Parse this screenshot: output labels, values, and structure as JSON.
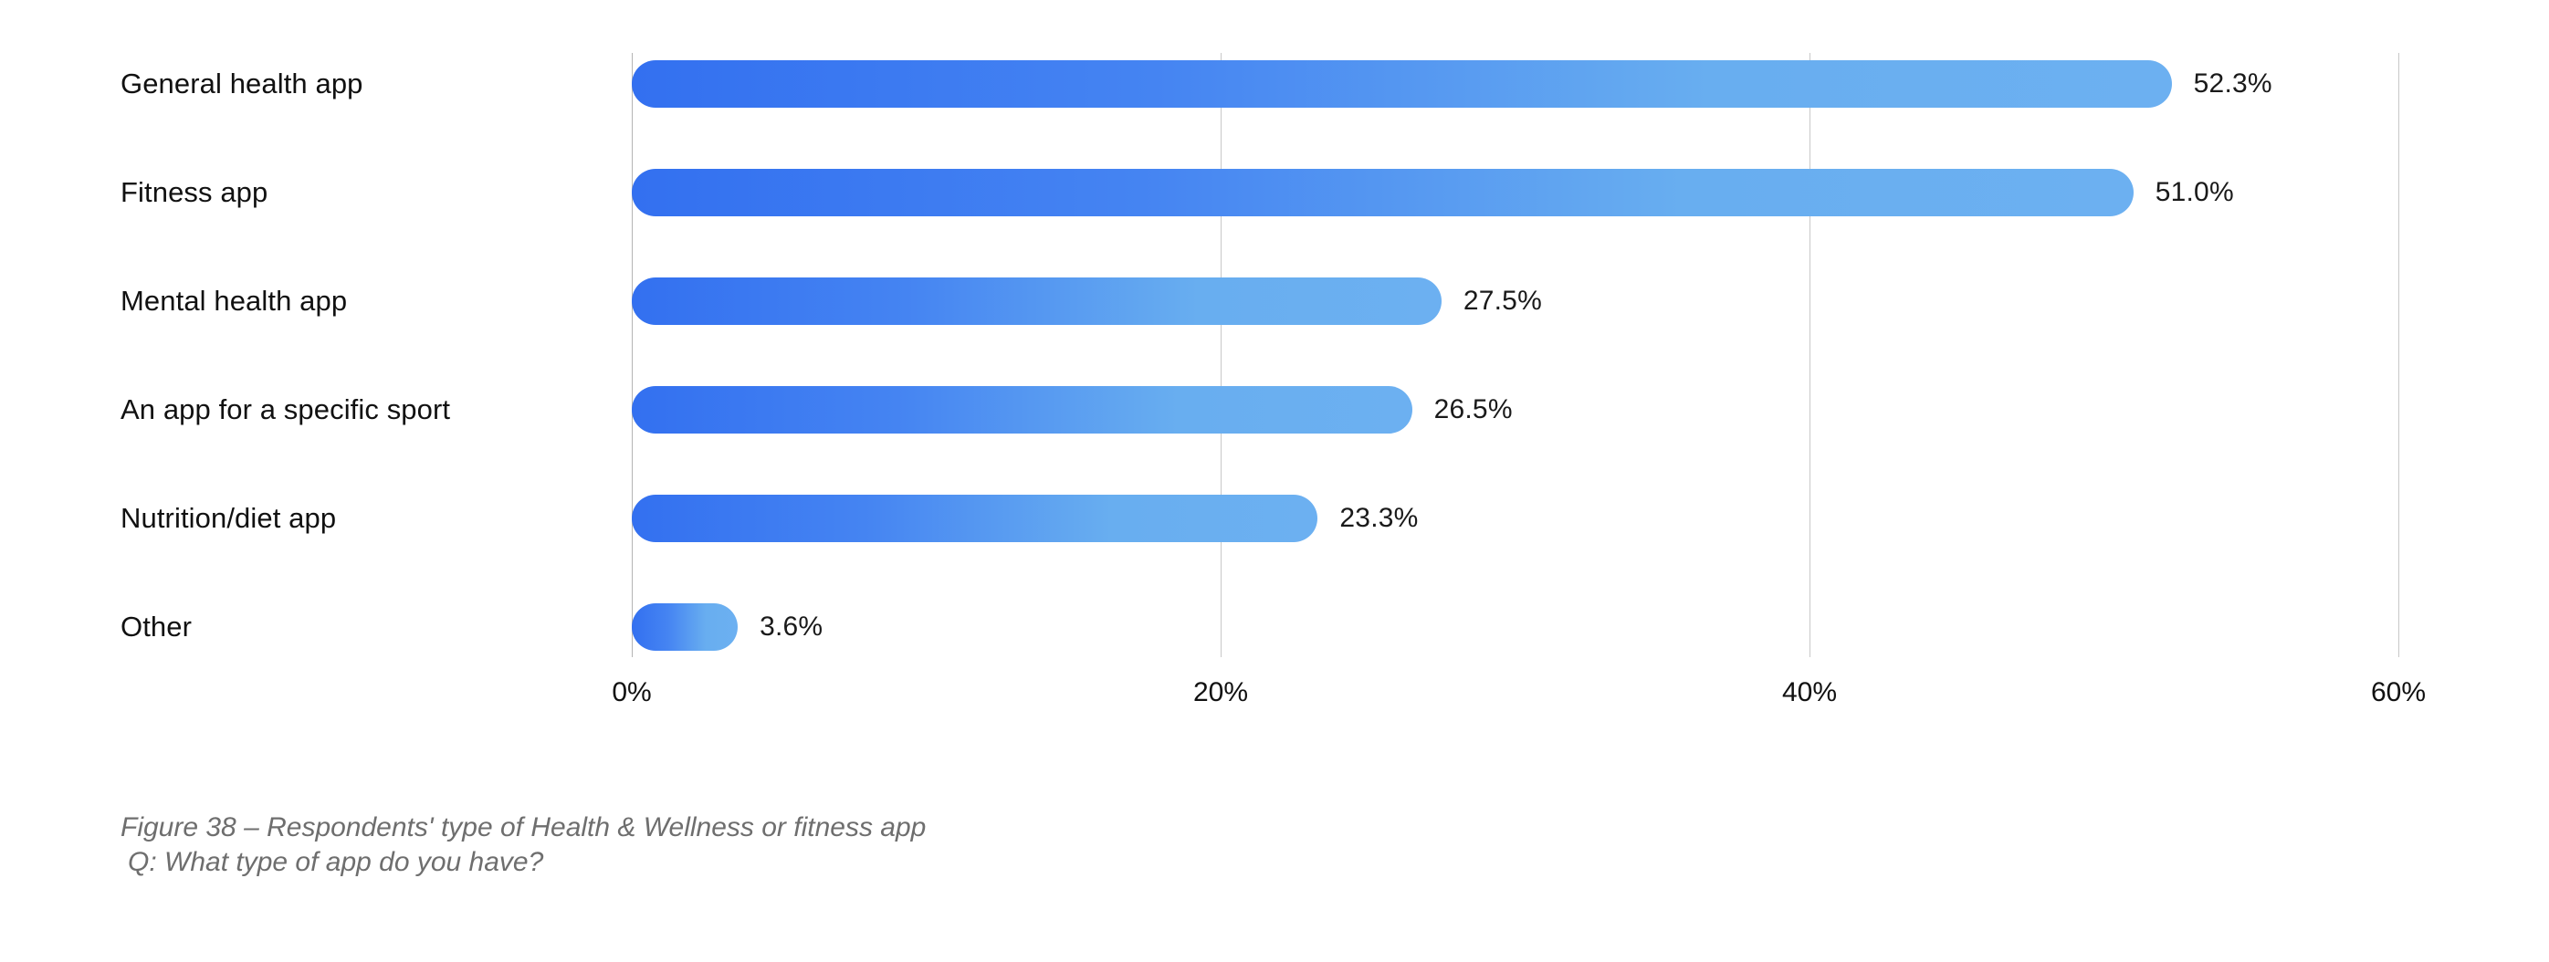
{
  "chart_data": {
    "type": "bar",
    "orientation": "horizontal",
    "categories": [
      "General health app",
      "Fitness app",
      "Mental health app",
      "An app for a specific sport",
      "Nutrition/diet app",
      "Other"
    ],
    "values": [
      52.3,
      51.0,
      27.5,
      26.5,
      23.3,
      3.6
    ],
    "value_labels": [
      "52.3%",
      "51.0%",
      "27.5%",
      "26.5%",
      "23.3%",
      "3.6%"
    ],
    "title": "",
    "xlabel": "",
    "ylabel": "",
    "xlim": [
      0,
      60
    ],
    "xticks": [
      0,
      20,
      40,
      60
    ],
    "xtick_labels": [
      "0%",
      "20%",
      "40%",
      "60%"
    ],
    "grid": true,
    "gridlines_at": [
      20,
      40,
      60
    ],
    "legend": "none",
    "bar_gradient_start": "#3370f0",
    "bar_gradient_end": "#68aef0",
    "gridline_color": "#c8c8c8",
    "axis_line_color": "#b4b4b4",
    "label_color": "#111111",
    "background": "#ffffff"
  },
  "caption": {
    "line1": "Figure 38  – Respondents' type of Health & Wellness or fitness app",
    "line2": "Q: What type of app do you have?",
    "color": "#6e6e6e"
  }
}
